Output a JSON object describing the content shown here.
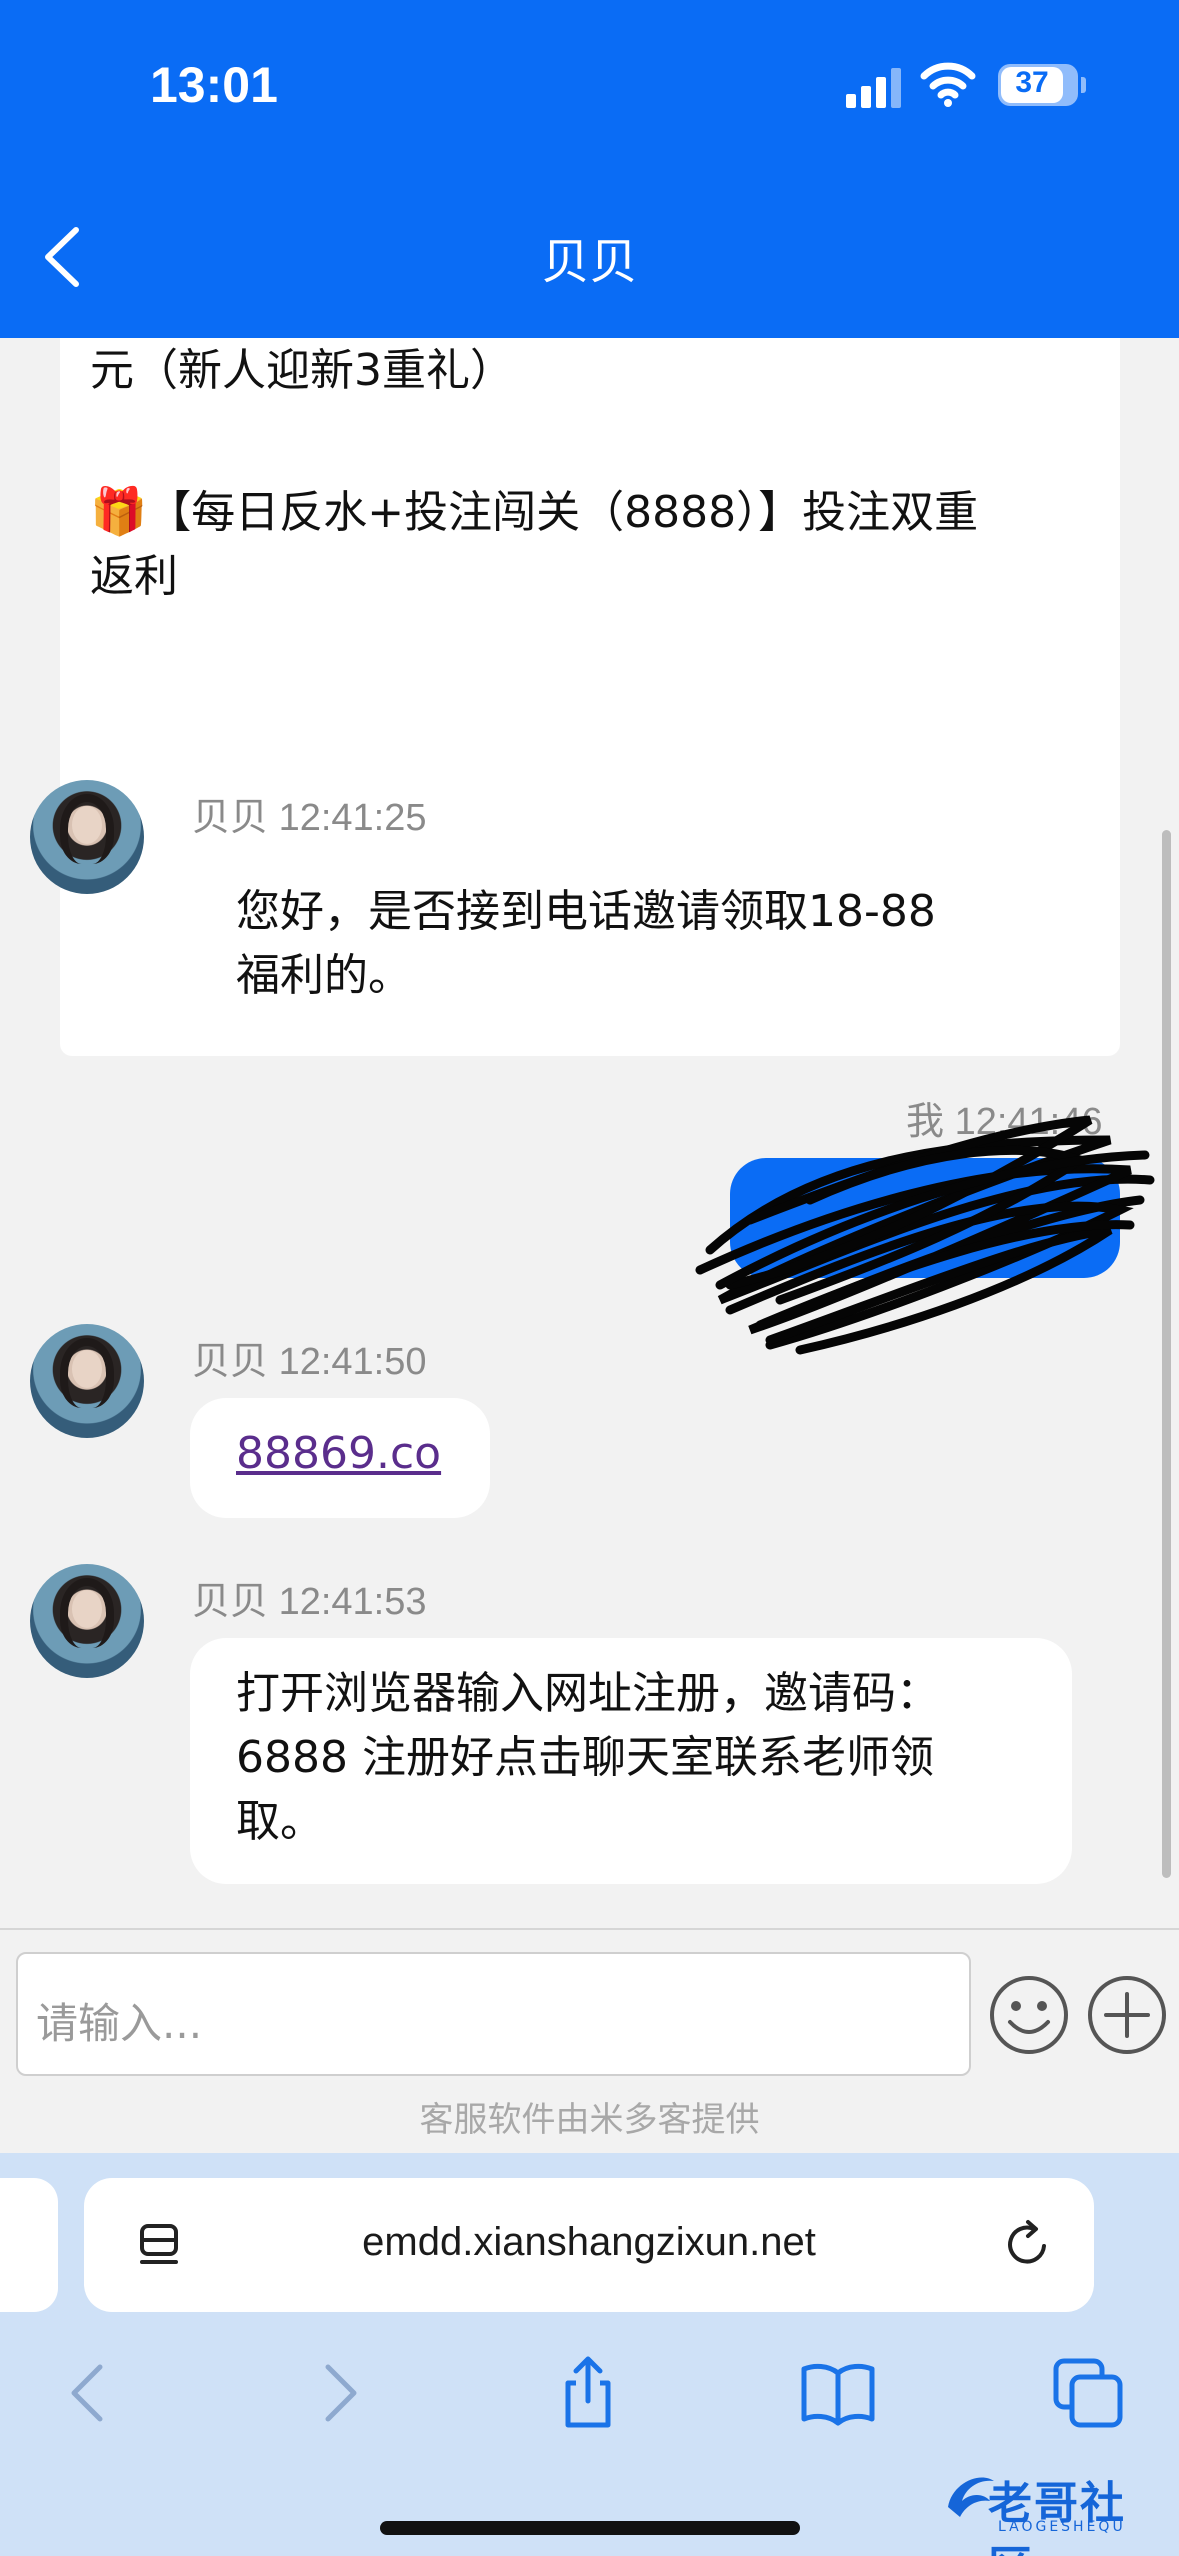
{
  "status_bar": {
    "time": "13:01",
    "battery": "37"
  },
  "header": {
    "title": "贝贝"
  },
  "promo_card": {
    "line1": "元（新人迎新3重礼）",
    "gift_emoji": "🎁",
    "line2": "【每日反水+投注闯关（8888）】投注双重",
    "line3": "返利"
  },
  "messages": [
    {
      "sender": "贝贝",
      "time": "12:41:25",
      "lines": [
        "您好，是否接到电话邀请领取18-88",
        "福利的。"
      ]
    },
    {
      "sender": "我",
      "time": "12:41:46",
      "text": ""
    },
    {
      "sender": "贝贝",
      "time": "12:41:50",
      "text": "88869.co"
    },
    {
      "sender": "贝贝",
      "time": "12:41:53",
      "lines": [
        "打开浏览器输入网址注册，邀请码：",
        "6888 注册好点击聊天室联系老师领",
        "取。"
      ]
    }
  ],
  "input": {
    "placeholder": "请输入..."
  },
  "footer": {
    "powered_by": "客服软件由米多客提供"
  },
  "browser": {
    "url": "emdd.xianshangzixun.net"
  },
  "watermark": {
    "text": "老哥社区",
    "sub": "LAOGESHEQU"
  },
  "colors": {
    "header_blue": "#0a6cf5",
    "my_bubble": "#0a6cf5",
    "browser_bar": "#cfe1f7"
  },
  "icons": [
    "back-icon",
    "signal-icon",
    "wifi-icon",
    "battery-icon",
    "emoji-icon",
    "plus-icon",
    "reader-icon",
    "reload-icon",
    "back-arrow-icon",
    "forward-arrow-icon",
    "share-icon",
    "bookmarks-icon",
    "tabs-icon"
  ]
}
